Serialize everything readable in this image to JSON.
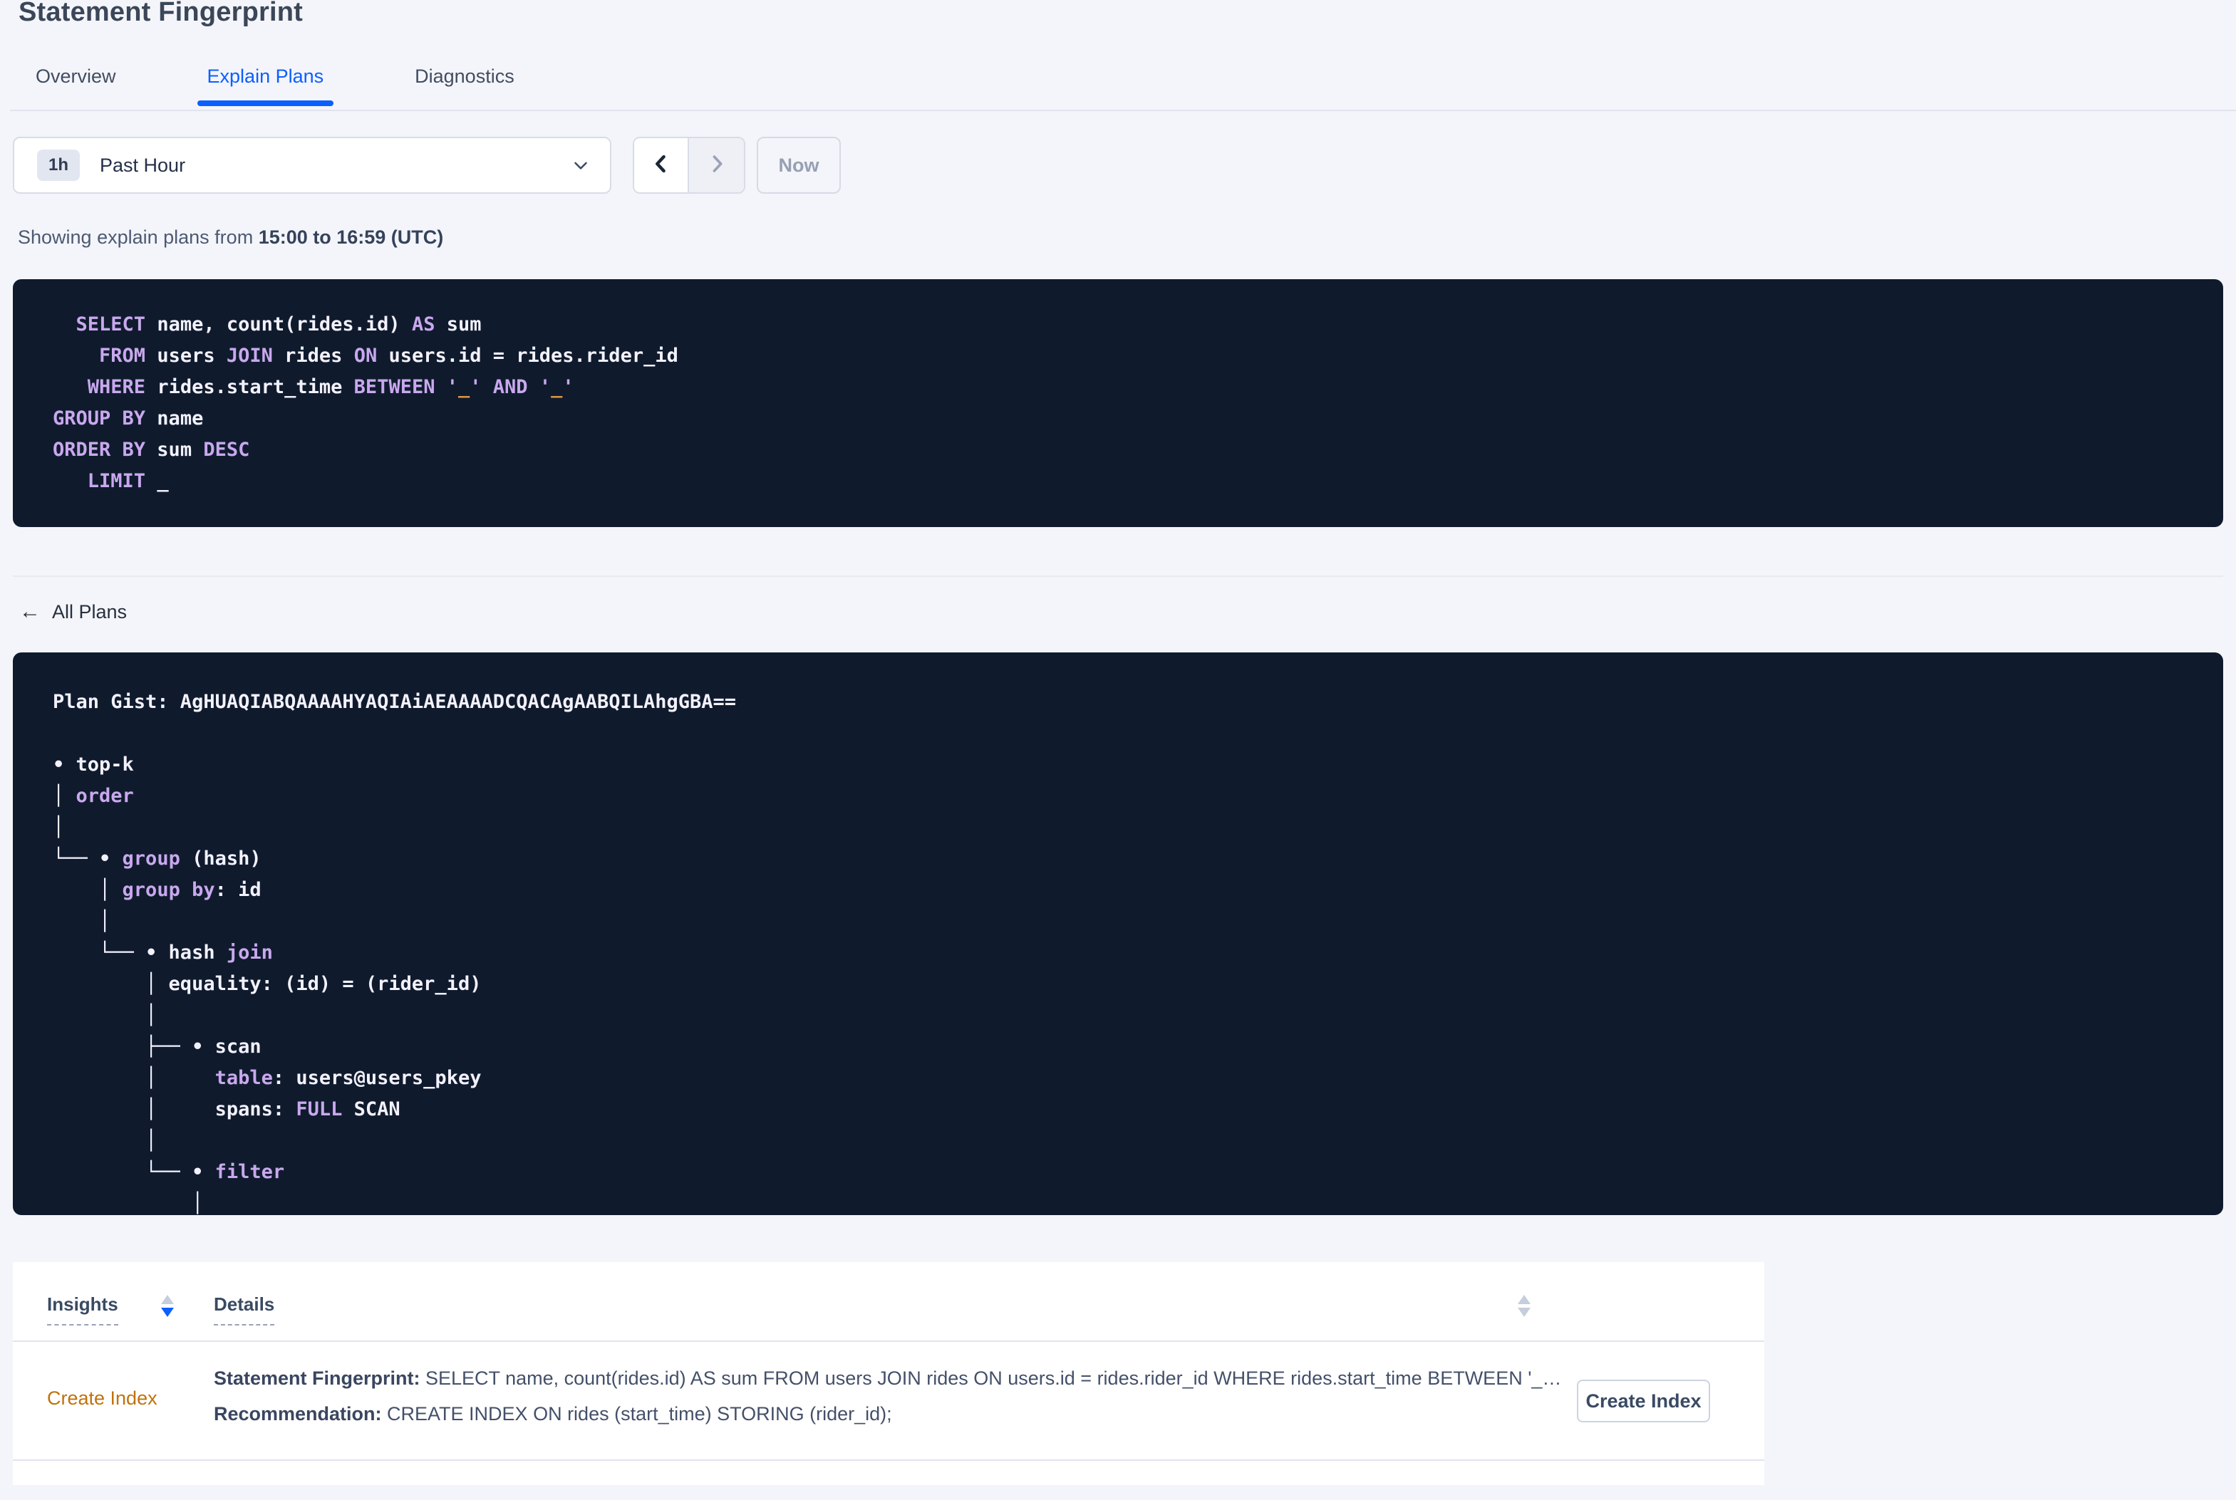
{
  "page": {
    "title": "Statement Fingerprint"
  },
  "tabs": [
    {
      "label": "Overview",
      "active": false
    },
    {
      "label": "Explain Plans",
      "active": true
    },
    {
      "label": "Diagnostics",
      "active": false
    }
  ],
  "time_picker": {
    "badge": "1h",
    "label": "Past Hour"
  },
  "nav": {
    "now_label": "Now"
  },
  "status": {
    "prefix": "Showing explain plans from ",
    "range": "15:00 to 16:59 (UTC)"
  },
  "sql": {
    "lines": [
      [
        [
          "p",
          "  "
        ],
        [
          "k",
          "SELECT"
        ],
        [
          "p",
          " name, count(rides.id) "
        ],
        [
          "k",
          "AS"
        ],
        [
          "p",
          " sum"
        ]
      ],
      [
        [
          "p",
          "    "
        ],
        [
          "k",
          "FROM"
        ],
        [
          "p",
          " users "
        ],
        [
          "k",
          "JOIN"
        ],
        [
          "p",
          " rides "
        ],
        [
          "k",
          "ON"
        ],
        [
          "p",
          " users.id = rides.rider_id"
        ]
      ],
      [
        [
          "p",
          "   "
        ],
        [
          "k",
          "WHERE"
        ],
        [
          "p",
          " rides.start_time "
        ],
        [
          "k",
          "BETWEEN"
        ],
        [
          "p",
          " "
        ],
        [
          "k",
          "'"
        ],
        [
          "o",
          "_"
        ],
        [
          "k",
          "'"
        ],
        [
          "p",
          " "
        ],
        [
          "k",
          "AND"
        ],
        [
          "p",
          " "
        ],
        [
          "k",
          "'"
        ],
        [
          "o",
          "_"
        ],
        [
          "k",
          "'"
        ]
      ],
      [
        [
          "k",
          "GROUP BY"
        ],
        [
          "p",
          " name"
        ]
      ],
      [
        [
          "k",
          "ORDER BY"
        ],
        [
          "p",
          " sum "
        ],
        [
          "k",
          "DESC"
        ]
      ],
      [
        [
          "p",
          "   "
        ],
        [
          "k",
          "LIMIT"
        ],
        [
          "p",
          " _"
        ]
      ]
    ]
  },
  "plans": {
    "back_label": "All Plans",
    "back_arrow": "←",
    "lines": [
      [
        [
          "p",
          "Plan Gist: AgHUAQIABQAAAAHYAQIAiAEAAAADCQACAgAABQILAhgGBA=="
        ]
      ],
      [],
      [
        [
          "p",
          "• top-k"
        ]
      ],
      [
        [
          "p",
          "│ "
        ],
        [
          "k",
          "order"
        ]
      ],
      [
        [
          "p",
          "│"
        ]
      ],
      [
        [
          "p",
          "└── • "
        ],
        [
          "k",
          "group"
        ],
        [
          "p",
          " (hash)"
        ]
      ],
      [
        [
          "p",
          "    │ "
        ],
        [
          "k",
          "group by"
        ],
        [
          "p",
          ": id"
        ]
      ],
      [
        [
          "p",
          "    │"
        ]
      ],
      [
        [
          "p",
          "    └── • hash "
        ],
        [
          "k",
          "join"
        ]
      ],
      [
        [
          "p",
          "        │ equality: (id) = (rider_id)"
        ]
      ],
      [
        [
          "p",
          "        │"
        ]
      ],
      [
        [
          "p",
          "        ├── • scan"
        ]
      ],
      [
        [
          "p",
          "        │     "
        ],
        [
          "k",
          "table"
        ],
        [
          "p",
          ": users@users_pkey"
        ]
      ],
      [
        [
          "p",
          "        │     spans: "
        ],
        [
          "k",
          "FULL"
        ],
        [
          "p",
          " SCAN"
        ]
      ],
      [
        [
          "p",
          "        │"
        ]
      ],
      [
        [
          "p",
          "        └── • "
        ],
        [
          "k",
          "filter"
        ]
      ],
      [
        [
          "p",
          "            │"
        ]
      ]
    ]
  },
  "insights_table": {
    "columns": {
      "insights": "Insights",
      "details": "Details"
    },
    "row": {
      "insight": "Create Index",
      "fingerprint_label": "Statement Fingerprint:",
      "fingerprint": " SELECT name, count(rides.id) AS sum FROM users JOIN rides ON users.id = rides.rider_id WHERE rides.start_time BETWEEN '_…",
      "recommendation_label": "Recommendation:",
      "recommendation": " CREATE INDEX ON rides (start_time) STORING (rider_id);",
      "action_label": "Create Index"
    }
  },
  "colors": {
    "accent_blue": "#0b5fff",
    "code_background": "#0f1b2d",
    "code_keyword": "#c9a8ee",
    "code_plain": "#f3f1fc",
    "code_literal_orange": "#e09540",
    "insight_link_orange": "#c0720c",
    "page_background": "#f4f5fa"
  }
}
